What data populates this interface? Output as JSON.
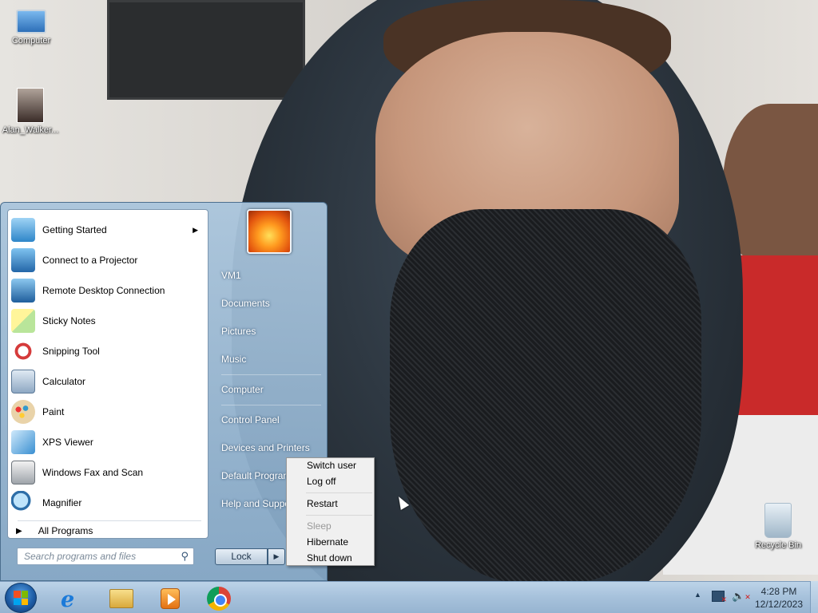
{
  "desktop": {
    "icons": [
      {
        "label": "Computer",
        "icon": "computer-icon"
      },
      {
        "label": "Alan_Walker...",
        "icon": "image-file-icon"
      },
      {
        "label": "Recycle Bin",
        "icon": "recycle-bin-icon"
      }
    ]
  },
  "start_menu": {
    "programs": [
      {
        "label": "Getting Started",
        "icon": "getting-started-icon",
        "has_submenu": true
      },
      {
        "label": "Connect to a Projector",
        "icon": "projector-icon"
      },
      {
        "label": "Remote Desktop Connection",
        "icon": "remote-desktop-icon"
      },
      {
        "label": "Sticky Notes",
        "icon": "sticky-notes-icon"
      },
      {
        "label": "Snipping Tool",
        "icon": "scissors-icon"
      },
      {
        "label": "Calculator",
        "icon": "calculator-icon"
      },
      {
        "label": "Paint",
        "icon": "paint-palette-icon"
      },
      {
        "label": "XPS Viewer",
        "icon": "xps-viewer-icon"
      },
      {
        "label": "Windows Fax and Scan",
        "icon": "fax-icon"
      },
      {
        "label": "Magnifier",
        "icon": "magnifier-icon"
      }
    ],
    "all_programs": "All Programs",
    "search_placeholder": "Search programs and files",
    "right_links": [
      "VM1",
      "Documents",
      "Pictures",
      "Music",
      "Computer",
      "Control Panel",
      "Devices and Printers",
      "Default Program",
      "Help and Suppo"
    ],
    "lock_label": "Lock"
  },
  "power_menu": {
    "items": [
      "Switch user",
      "Log off",
      "Restart",
      "Sleep",
      "Hibernate",
      "Shut down"
    ],
    "disabled": [
      "Sleep"
    ]
  },
  "taskbar": {
    "pinned": [
      {
        "name": "Internet Explorer",
        "icon": "internet-explorer-icon"
      },
      {
        "name": "Windows Explorer",
        "icon": "folder-icon"
      },
      {
        "name": "Windows Media Player",
        "icon": "media-player-icon"
      },
      {
        "name": "Google Chrome",
        "icon": "chrome-icon"
      }
    ],
    "clock_time": "4:28 PM",
    "clock_date": "12/12/2023"
  },
  "colors": {
    "start_menu_glass": "#a7c1da",
    "taskbar": "#a6c1db",
    "disabled_text": "#9a9a9a"
  }
}
